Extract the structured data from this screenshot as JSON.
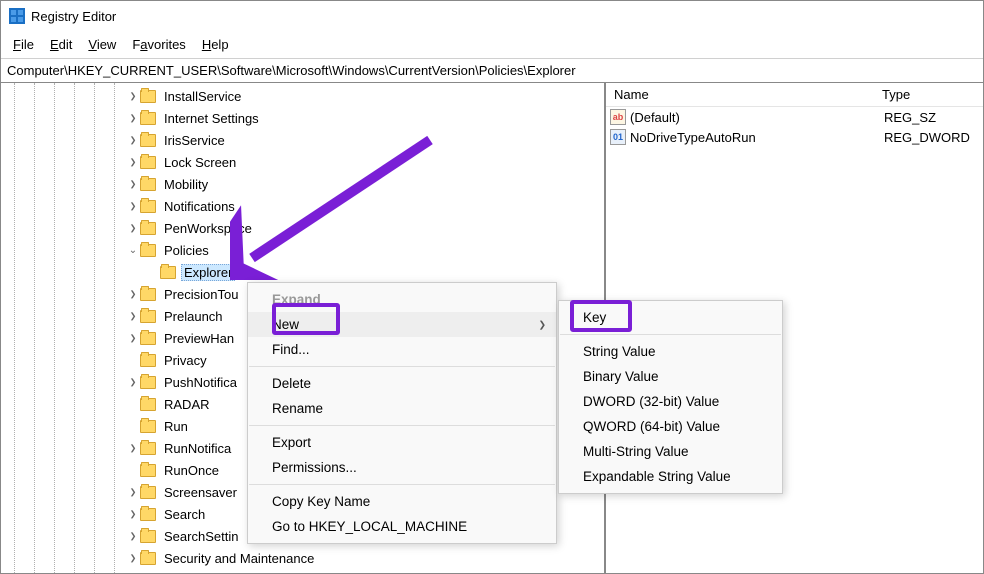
{
  "app": {
    "title": "Registry Editor",
    "address": "Computer\\HKEY_CURRENT_USER\\Software\\Microsoft\\Windows\\CurrentVersion\\Policies\\Explorer"
  },
  "menubar": {
    "file_html": "<u>F</u>ile",
    "edit_html": "<u>E</u>dit",
    "view_html": "<u>V</u>iew",
    "favorites_html": "F<u>a</u>vorites",
    "help_html": "<u>H</u>elp"
  },
  "tree": {
    "items": [
      {
        "label": "InstallService",
        "exp": "›",
        "indent": 125
      },
      {
        "label": "Internet Settings",
        "exp": "›",
        "indent": 125
      },
      {
        "label": "IrisService",
        "exp": "›",
        "indent": 125
      },
      {
        "label": "Lock Screen",
        "exp": "›",
        "indent": 125
      },
      {
        "label": "Mobility",
        "exp": "›",
        "indent": 125
      },
      {
        "label": "Notifications",
        "exp": "›",
        "indent": 125
      },
      {
        "label": "PenWorkspace",
        "exp": "›",
        "indent": 125
      },
      {
        "label": "Policies",
        "exp": "⌄",
        "indent": 125
      },
      {
        "label": "Explorer",
        "exp": " ",
        "indent": 145,
        "selected": true
      },
      {
        "label": "PrecisionTou",
        "exp": "›",
        "indent": 125
      },
      {
        "label": "Prelaunch",
        "exp": "›",
        "indent": 125
      },
      {
        "label": "PreviewHan",
        "exp": "›",
        "indent": 125
      },
      {
        "label": "Privacy",
        "exp": " ",
        "indent": 125
      },
      {
        "label": "PushNotifica",
        "exp": "›",
        "indent": 125
      },
      {
        "label": "RADAR",
        "exp": " ",
        "indent": 125
      },
      {
        "label": "Run",
        "exp": " ",
        "indent": 125
      },
      {
        "label": "RunNotifica",
        "exp": "›",
        "indent": 125
      },
      {
        "label": "RunOnce",
        "exp": " ",
        "indent": 125
      },
      {
        "label": "Screensaver",
        "exp": "›",
        "indent": 125
      },
      {
        "label": "Search",
        "exp": "›",
        "indent": 125
      },
      {
        "label": "SearchSettin",
        "exp": "›",
        "indent": 125
      },
      {
        "label": "Security and Maintenance",
        "exp": "›",
        "indent": 125
      }
    ]
  },
  "list": {
    "col_name": "Name",
    "col_type": "Type",
    "rows": [
      {
        "icon": "sz",
        "icon_text": "ab",
        "name": "(Default)",
        "type": "REG_SZ"
      },
      {
        "icon": "dw",
        "icon_text": "01",
        "name": "NoDriveTypeAutoRun",
        "type": "REG_DWORD"
      }
    ]
  },
  "context_menu_1": {
    "expand": "Expand",
    "new": "New",
    "find": "Find...",
    "delete": "Delete",
    "rename": "Rename",
    "export": "Export",
    "permissions": "Permissions...",
    "copy_key_name": "Copy Key Name",
    "goto_hklm": "Go to HKEY_LOCAL_MACHINE"
  },
  "context_menu_2": {
    "key": "Key",
    "string": "String Value",
    "binary": "Binary Value",
    "dword": "DWORD (32-bit) Value",
    "qword": "QWORD (64-bit) Value",
    "multi": "Multi-String Value",
    "expand": "Expandable String Value"
  }
}
